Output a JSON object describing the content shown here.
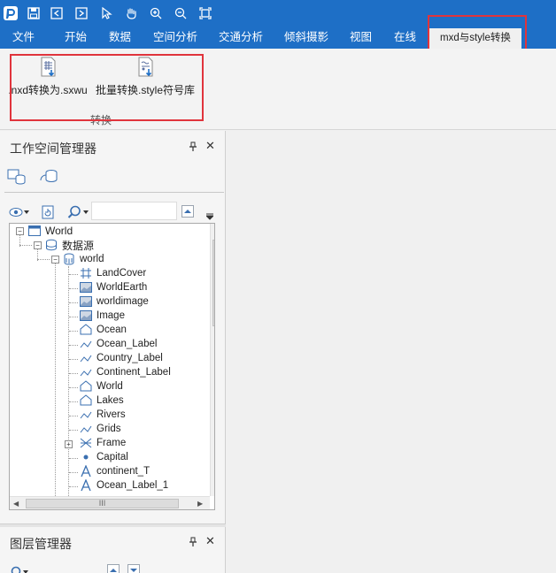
{
  "menu": {
    "items": [
      "文件",
      "开始",
      "数据",
      "空间分析",
      "交通分析",
      "倾斜摄影",
      "视图",
      "在线"
    ],
    "active": "mxd与style转换"
  },
  "ribbon": {
    "buttons": [
      ".nxd转换为.sxwu",
      "批量转换.style符号库"
    ],
    "group_label": "转换"
  },
  "workspace": {
    "title": "工作空间管理器",
    "pin": "↑",
    "close": "✕",
    "tree": {
      "root": "World",
      "datasources": "数据源",
      "datasource": "world",
      "datasets": [
        {
          "name": "LandCover",
          "icon": "grid-icon"
        },
        {
          "name": "WorldEarth",
          "icon": "image-icon"
        },
        {
          "name": "worldimage",
          "icon": "image-icon"
        },
        {
          "name": "Image",
          "icon": "image-icon"
        },
        {
          "name": "Ocean",
          "icon": "region-icon"
        },
        {
          "name": "Ocean_Label",
          "icon": "line-icon"
        },
        {
          "name": "Country_Label",
          "icon": "line-icon"
        },
        {
          "name": "Continent_Label",
          "icon": "line-icon"
        },
        {
          "name": "World",
          "icon": "region-icon"
        },
        {
          "name": "Lakes",
          "icon": "region-icon"
        },
        {
          "name": "Rivers",
          "icon": "line-icon"
        },
        {
          "name": "Grids",
          "icon": "line-icon"
        },
        {
          "name": "Frame",
          "icon": "network-icon"
        },
        {
          "name": "Capital",
          "icon": "point-icon"
        },
        {
          "name": "continent_T",
          "icon": "text-icon"
        },
        {
          "name": "Ocean_Label_1",
          "icon": "text-icon"
        }
      ]
    },
    "scroll_grip": "≡",
    "hscroll_grip": "III"
  },
  "layers": {
    "title": "图层管理器",
    "pin": "↑",
    "close": "✕"
  },
  "colors": {
    "accent": "#1e6fc6",
    "highlight": "#e0343c"
  }
}
